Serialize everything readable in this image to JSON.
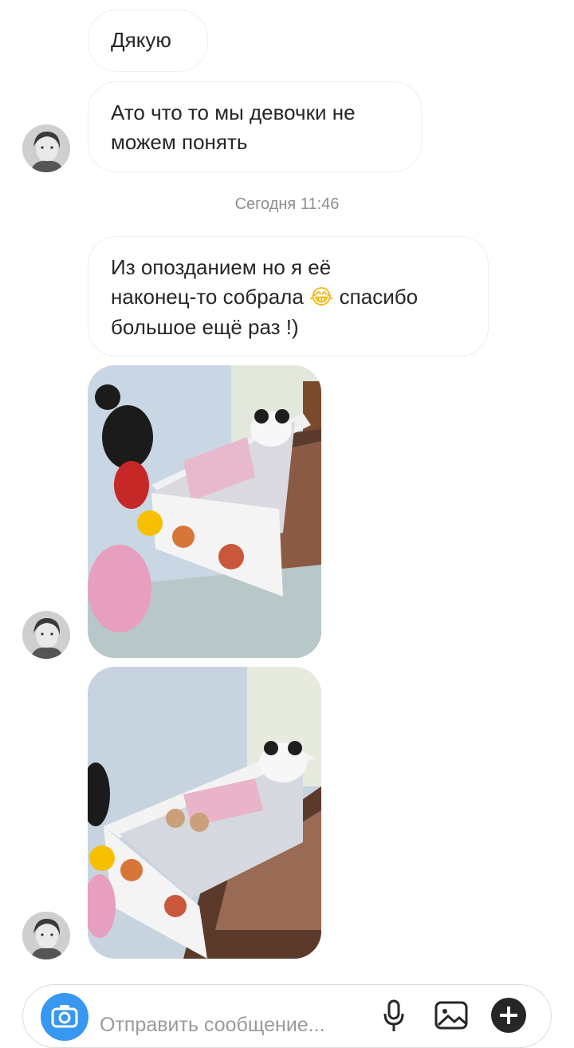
{
  "messages": [
    {
      "text": "Дякую"
    },
    {
      "lines": [
        "Ато что то мы девочки не",
        "можем понять"
      ]
    },
    {
      "lines": [
        "Из опозданием но я её",
        "наконец-то собрала",
        "спасибо",
        "большое ещё раз !)"
      ],
      "emoji": "😂"
    }
  ],
  "timestamp": "Сегодня 11:46",
  "composer": {
    "placeholder": "Отправить сообщение..."
  },
  "icons": {
    "camera": "camera-icon",
    "mic": "microphone-icon",
    "gallery": "gallery-icon",
    "more": "plus-circle-icon"
  },
  "colors": {
    "accent": "#3897f0",
    "bubble_border": "#efefef",
    "meta_text": "#8e8e8e"
  }
}
